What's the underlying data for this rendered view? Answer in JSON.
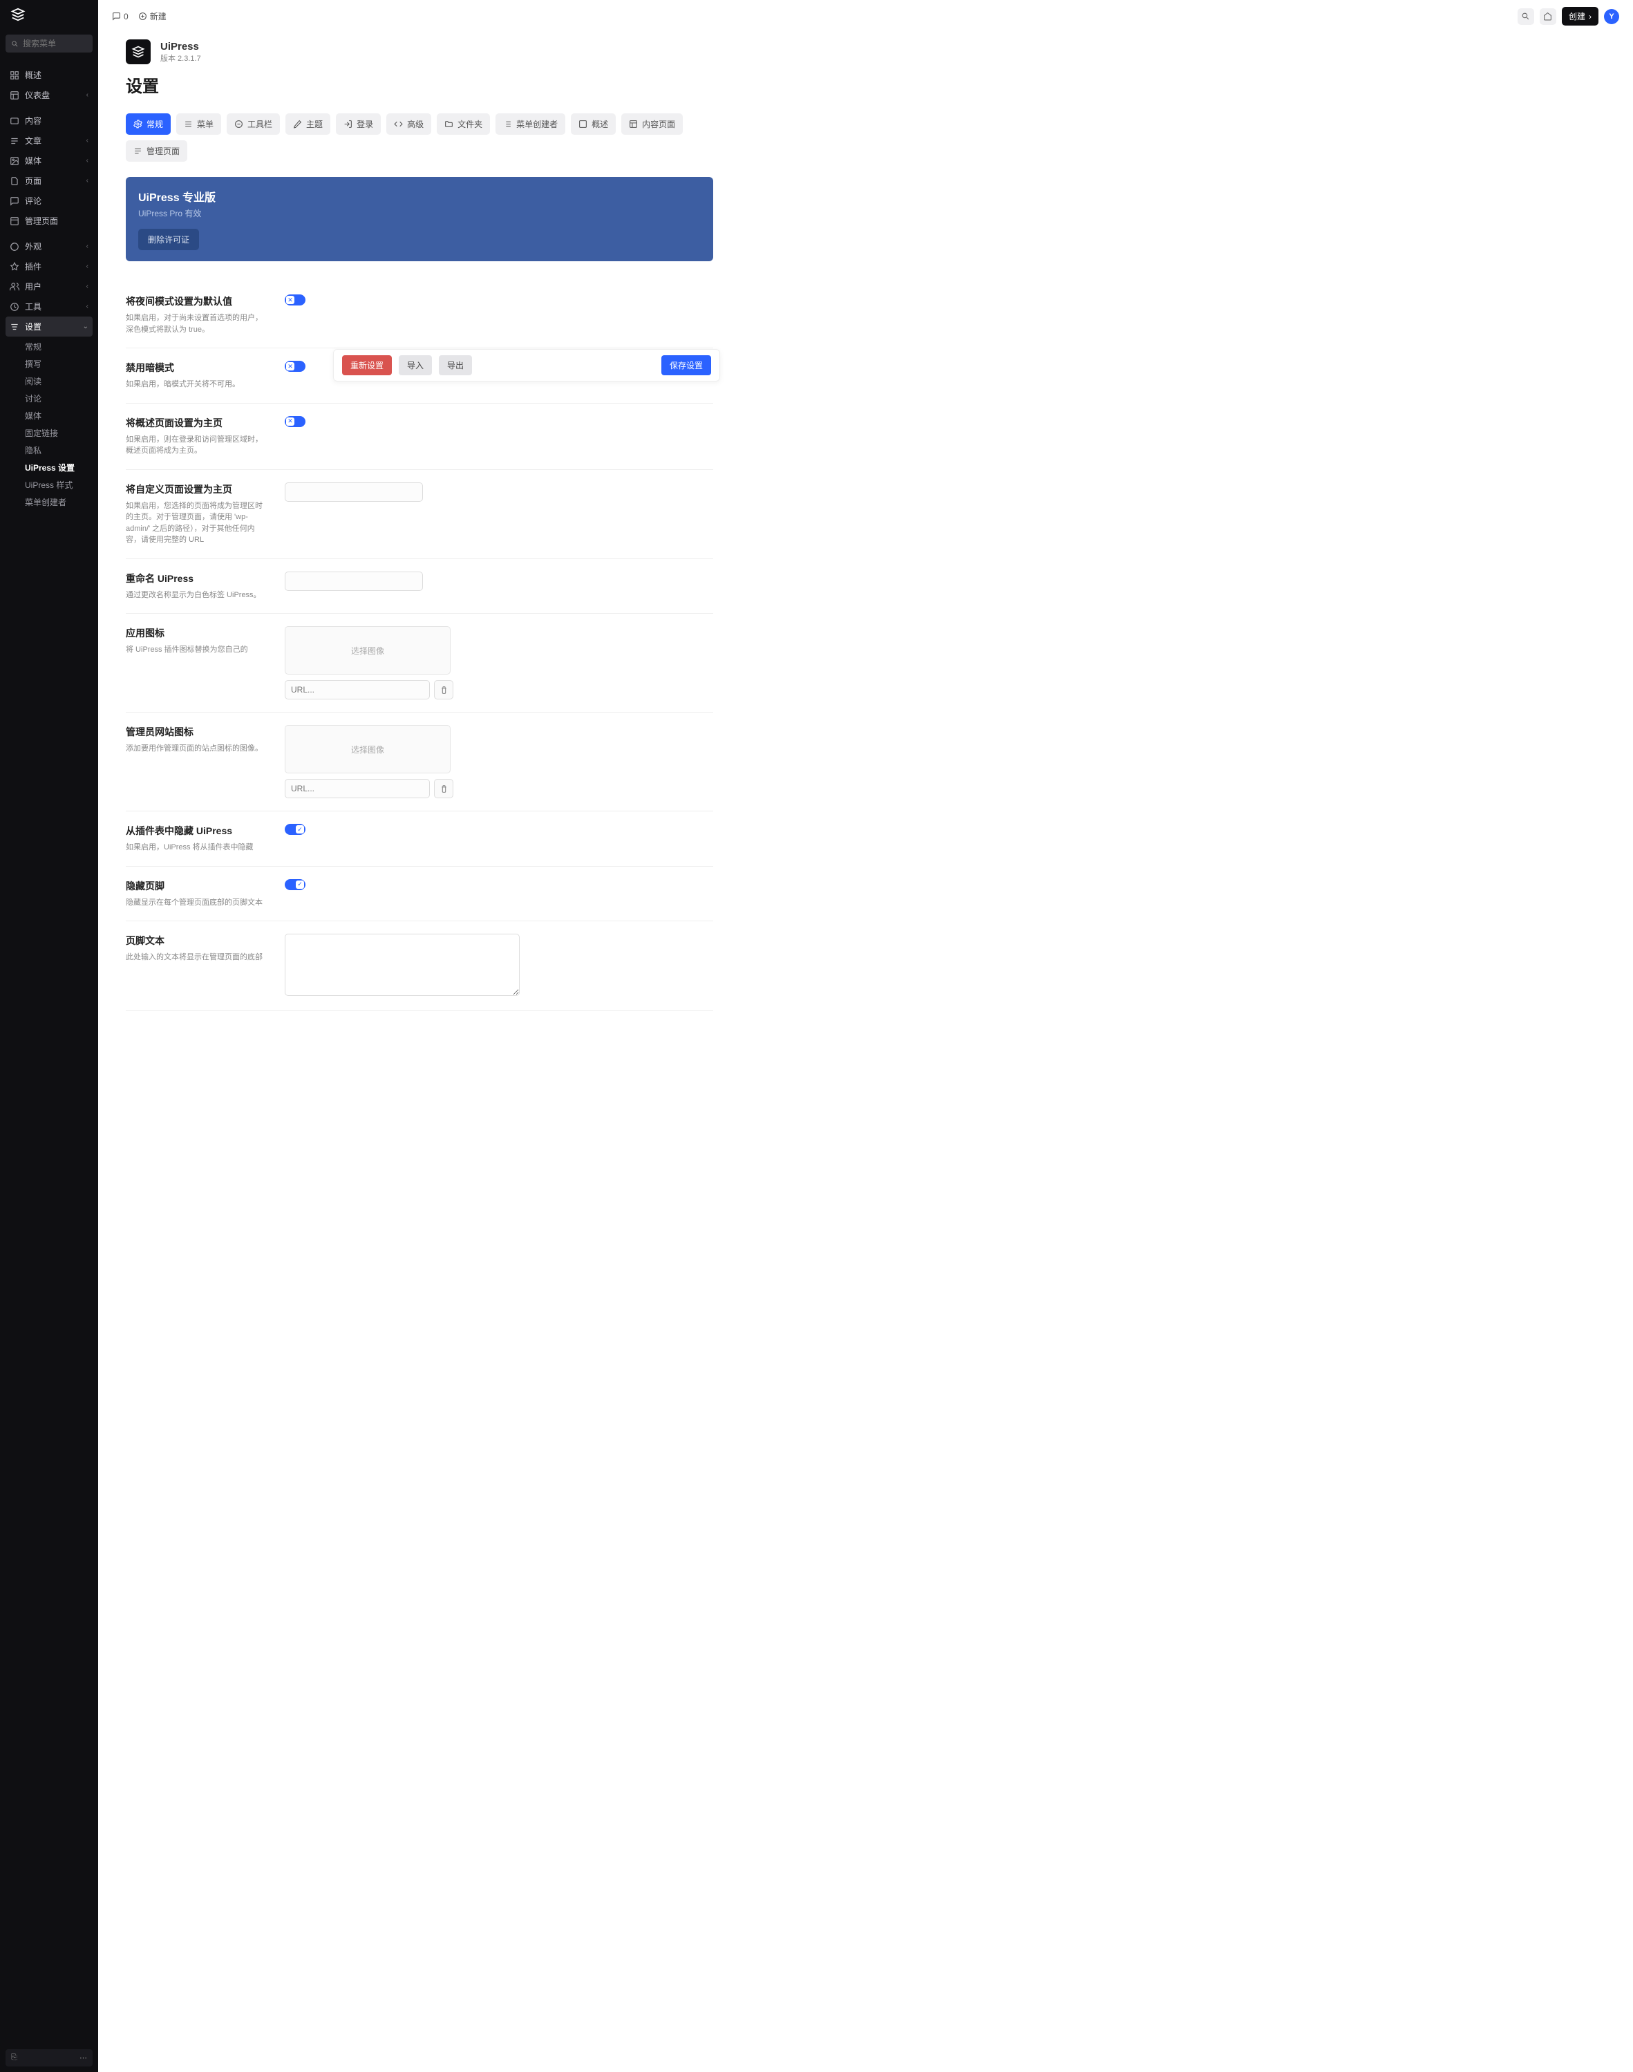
{
  "search": {
    "placeholder": "搜索菜单"
  },
  "topbar": {
    "comments": "0",
    "new_label": "新建",
    "create_label": "创建",
    "avatar": "Y"
  },
  "nav": {
    "overview": "概述",
    "dashboard": "仪表盘",
    "content": "内容",
    "posts": "文章",
    "media": "媒体",
    "pages": "页面",
    "comments": "评论",
    "manage_pages": "管理页面",
    "appearance": "外观",
    "plugins": "插件",
    "users": "用户",
    "tools": "工具",
    "settings": "设置",
    "sub": {
      "general": "常规",
      "writing": "撰写",
      "reading": "阅读",
      "discussion": "讨论",
      "media": "媒体",
      "permalinks": "固定链接",
      "privacy": "隐私",
      "uipress_settings": "UiPress 设置",
      "uipress_styles": "UiPress 样式",
      "menu_creator": "菜单创建者"
    }
  },
  "page": {
    "app_name": "UiPress",
    "version": "版本 2.3.1.7",
    "title": "设置"
  },
  "tabs": {
    "general": "常规",
    "menu": "菜单",
    "toolbar": "工具栏",
    "theme": "主题",
    "login": "登录",
    "advanced": "高级",
    "folders": "文件夹",
    "menu_creator": "菜单创建者",
    "overview": "概述",
    "content_pages": "内容页面",
    "manage_pages": "管理页面"
  },
  "banner": {
    "title": "UiPress 专业版",
    "subtitle": "UiPress Pro 有效",
    "btn": "删除许可证"
  },
  "settings": {
    "dark_default": {
      "title": "将夜间模式设置为默认值",
      "desc": "如果启用，对于尚未设置首选项的用户，深色模式将默认为 true。"
    },
    "disable_dark": {
      "title": "禁用暗模式",
      "desc": "如果启用，暗模式开关将不可用。"
    },
    "overview_home": {
      "title": "将概述页面设置为主页",
      "desc": "如果启用，则在登录和访问管理区域时，概述页面将成为主页。"
    },
    "custom_home": {
      "title": "将自定义页面设置为主页",
      "desc": "如果启用，您选择的页面将成为管理区时的主页。对于管理页面，请使用 'wp-admin/' 之后的路径），对于其他任何内容，请使用完整的 URL"
    },
    "rename": {
      "title": "重命名 UiPress",
      "desc": "通过更改名称显示为白色标签 UiPress。"
    },
    "app_icon": {
      "title": "应用图标",
      "desc": "将 UiPress 插件图标替换为您自己的"
    },
    "favicon": {
      "title": "管理员网站图标",
      "desc": "添加要用作管理页面的站点图标的图像。"
    },
    "hide_plugin": {
      "title": "从插件表中隐藏 UiPress",
      "desc": "如果启用，UiPress 将从插件表中隐藏"
    },
    "hide_footer": {
      "title": "隐藏页脚",
      "desc": "隐藏显示在每个管理页面底部的页脚文本"
    },
    "footer_text": {
      "title": "页脚文本",
      "desc": "此处输入的文本将显示在管理页面的底部"
    }
  },
  "placeholders": {
    "select_image": "选择图像",
    "url": "URL..."
  },
  "actions": {
    "reset": "重新设置",
    "import": "导入",
    "export": "导出",
    "save": "保存设置"
  }
}
